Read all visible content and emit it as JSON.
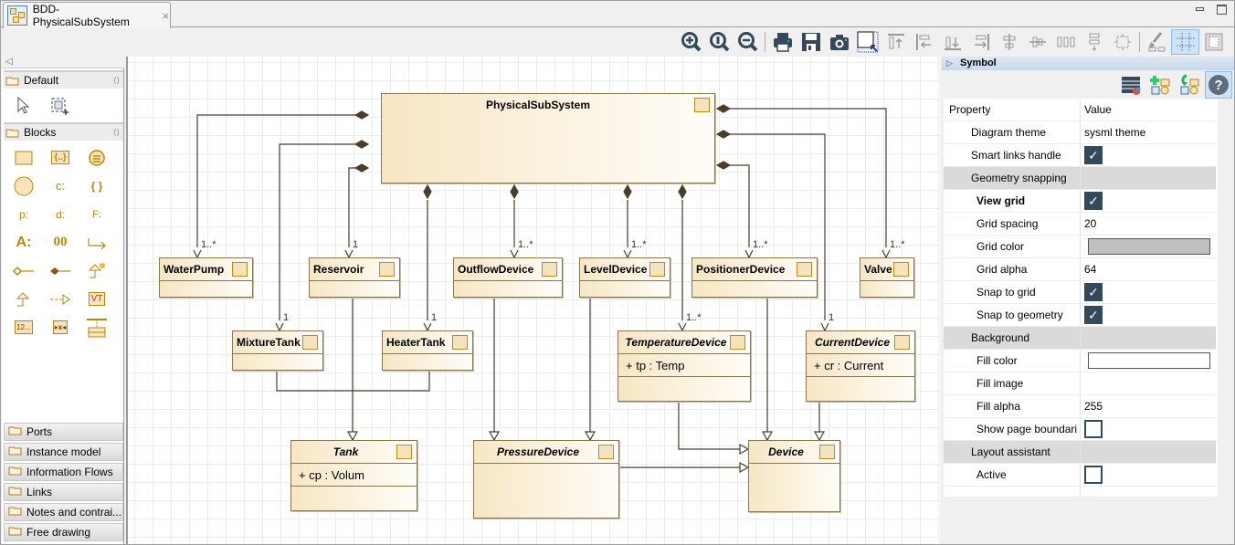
{
  "tab": {
    "title": "BDD-PhysicalSubSystem",
    "close": "⨯"
  },
  "toolbar": {
    "items": [
      "zoom-in",
      "zoom-fit",
      "zoom-out",
      "print",
      "save",
      "snapshot",
      "select-region",
      "align-top",
      "align-left",
      "align-bottom",
      "align-right",
      "align-center-h",
      "align-center-v",
      "distribute-h",
      "distribute-v",
      "same-size",
      "format-painter",
      "grid-toggle",
      "layout"
    ]
  },
  "palette": {
    "collapse": "◁",
    "default": {
      "label": "Default",
      "tools": [
        "select-arrow",
        "marquee-select"
      ]
    },
    "blocks": {
      "label": "Blocks",
      "tools": [
        {
          "name": "block",
          "glyph": ""
        },
        {
          "name": "value-type",
          "glyph": "{..}"
        },
        {
          "name": "enumeration",
          "glyph": "≡"
        },
        {
          "name": "actor",
          "glyph": ""
        },
        {
          "name": "constraint-property",
          "glyph": "c:"
        },
        {
          "name": "constraint-block",
          "glyph": "{ }"
        },
        {
          "name": "part-property",
          "glyph": "p:"
        },
        {
          "name": "data-property",
          "glyph": "d:"
        },
        {
          "name": "flow-property",
          "glyph": "F:"
        },
        {
          "name": "attribute",
          "glyph": "A:"
        },
        {
          "name": "operation",
          "glyph": "00"
        },
        {
          "name": "dependency",
          "glyph": "↳"
        },
        {
          "name": "aggregation",
          "glyph": "◇—"
        },
        {
          "name": "composition",
          "glyph": "◆—"
        },
        {
          "name": "generalization-smart",
          "glyph": "△"
        },
        {
          "name": "generalization",
          "glyph": "△"
        },
        {
          "name": "realization",
          "glyph": "- -▷"
        },
        {
          "name": "value-type-vt",
          "glyph": "VT"
        },
        {
          "name": "literal",
          "glyph": "12..."
        },
        {
          "name": "port-connector",
          "glyph": "▸x◂"
        },
        {
          "name": "association-block",
          "glyph": "⊤"
        }
      ]
    },
    "drawers": [
      "Ports",
      "Instance model",
      "Information Flows",
      "Links",
      "Notes and contrai...",
      "Free drawing"
    ]
  },
  "diagram": {
    "blocks": [
      {
        "id": "physicalsubsystem",
        "name": "PhysicalSubSystem",
        "italic": false,
        "attrs": []
      },
      {
        "id": "waterpump",
        "name": "WaterPump",
        "italic": false,
        "attrs": []
      },
      {
        "id": "reservoir",
        "name": "Reservoir",
        "italic": false,
        "attrs": []
      },
      {
        "id": "outflowdevice",
        "name": "OutflowDevice",
        "italic": false,
        "attrs": []
      },
      {
        "id": "leveldevice",
        "name": "LevelDevice",
        "italic": false,
        "attrs": []
      },
      {
        "id": "positionerdevice",
        "name": "PositionerDevice",
        "italic": false,
        "attrs": []
      },
      {
        "id": "valve",
        "name": "Valve",
        "italic": false,
        "attrs": []
      },
      {
        "id": "mixturetank",
        "name": "MixtureTank",
        "italic": false,
        "attrs": []
      },
      {
        "id": "heatertank",
        "name": "HeaterTank",
        "italic": false,
        "attrs": []
      },
      {
        "id": "temperaturedevice",
        "name": "TemperatureDevice",
        "italic": true,
        "attrs": [
          "+ tp : Temp"
        ]
      },
      {
        "id": "currentdevice",
        "name": "CurrentDevice",
        "italic": true,
        "attrs": [
          "+ cr : Current"
        ]
      },
      {
        "id": "tank",
        "name": "Tank",
        "italic": true,
        "attrs": [
          "+ cp : Volum"
        ]
      },
      {
        "id": "pressuredevice",
        "name": "PressureDevice",
        "italic": true,
        "attrs": []
      },
      {
        "id": "device",
        "name": "Device",
        "italic": true,
        "attrs": []
      }
    ],
    "multiplicities": {
      "waterpump": "1..*",
      "reservoir": "1",
      "outflowdevice": "1..*",
      "leveldevice": "1..*",
      "positionerdevice": "1..*",
      "valve": "1..*",
      "mixturetank": "1",
      "heatertank": "1",
      "temperaturedevice": "1..*",
      "currentdevice": "1"
    },
    "compositions": [
      "waterpump",
      "reservoir",
      "outflowdevice",
      "leveldevice",
      "positionerdevice",
      "valve",
      "mixturetank",
      "heatertank",
      "temperaturedevice",
      "currentdevice"
    ],
    "generalizations": [
      [
        "mixturetank",
        "tank"
      ],
      [
        "heatertank",
        "tank"
      ],
      [
        "reservoir",
        "tank"
      ],
      [
        "outflowdevice",
        "pressuredevice"
      ],
      [
        "leveldevice",
        "pressuredevice"
      ],
      [
        "temperaturedevice",
        "device"
      ],
      [
        "pressuredevice",
        "device"
      ],
      [
        "positionerdevice",
        "device"
      ],
      [
        "currentdevice",
        "device"
      ]
    ]
  },
  "properties": {
    "section": "Symbol",
    "tools": [
      "edit-properties",
      "add-element",
      "import-element",
      "help"
    ],
    "header": {
      "property": "Property",
      "value": "Value"
    },
    "rows": [
      {
        "type": "item",
        "label": "Diagram theme",
        "value": "sysml theme"
      },
      {
        "type": "item",
        "label": "Smart links handle",
        "check": true
      },
      {
        "type": "group",
        "label": "Geometry snapping"
      },
      {
        "type": "item2",
        "label": "View grid",
        "check": true,
        "bold": true
      },
      {
        "type": "item2",
        "label": "Grid spacing",
        "value": "20"
      },
      {
        "type": "item2",
        "label": "Grid color",
        "color": "#c0c0c0"
      },
      {
        "type": "item2",
        "label": "Grid alpha",
        "value": "64"
      },
      {
        "type": "item2",
        "label": "Snap to grid",
        "check": true
      },
      {
        "type": "item2",
        "label": "Snap to geometry",
        "check": true
      },
      {
        "type": "group",
        "label": "Background"
      },
      {
        "type": "item2",
        "label": "Fill color",
        "color": "#ffffff"
      },
      {
        "type": "item2",
        "label": "Fill image",
        "value": ""
      },
      {
        "type": "item2",
        "label": "Fill alpha",
        "value": "255"
      },
      {
        "type": "item2",
        "label": "Show page boundari",
        "check": false
      },
      {
        "type": "group",
        "label": "Layout assistant"
      },
      {
        "type": "item2",
        "label": "Active",
        "check": false
      }
    ]
  }
}
